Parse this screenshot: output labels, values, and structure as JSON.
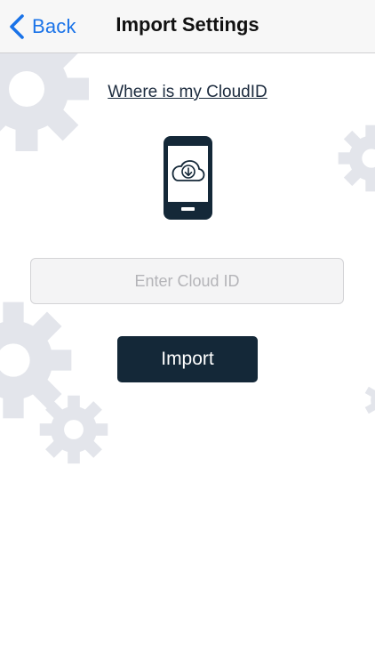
{
  "navbar": {
    "back_label": "Back",
    "title": "Import Settings"
  },
  "content": {
    "help_link": "Where is my CloudID",
    "cloud_id_placeholder": "Enter Cloud ID",
    "cloud_id_value": "",
    "import_label": "Import"
  },
  "icons": {
    "back": "chevron-left-icon",
    "phone": "phone-cloud-download-icon",
    "background": "gear-icon"
  },
  "colors": {
    "accent": "#1a73e8",
    "button": "#142838",
    "gear": "#e3e5eb",
    "navbar": "#f7f7f7"
  }
}
